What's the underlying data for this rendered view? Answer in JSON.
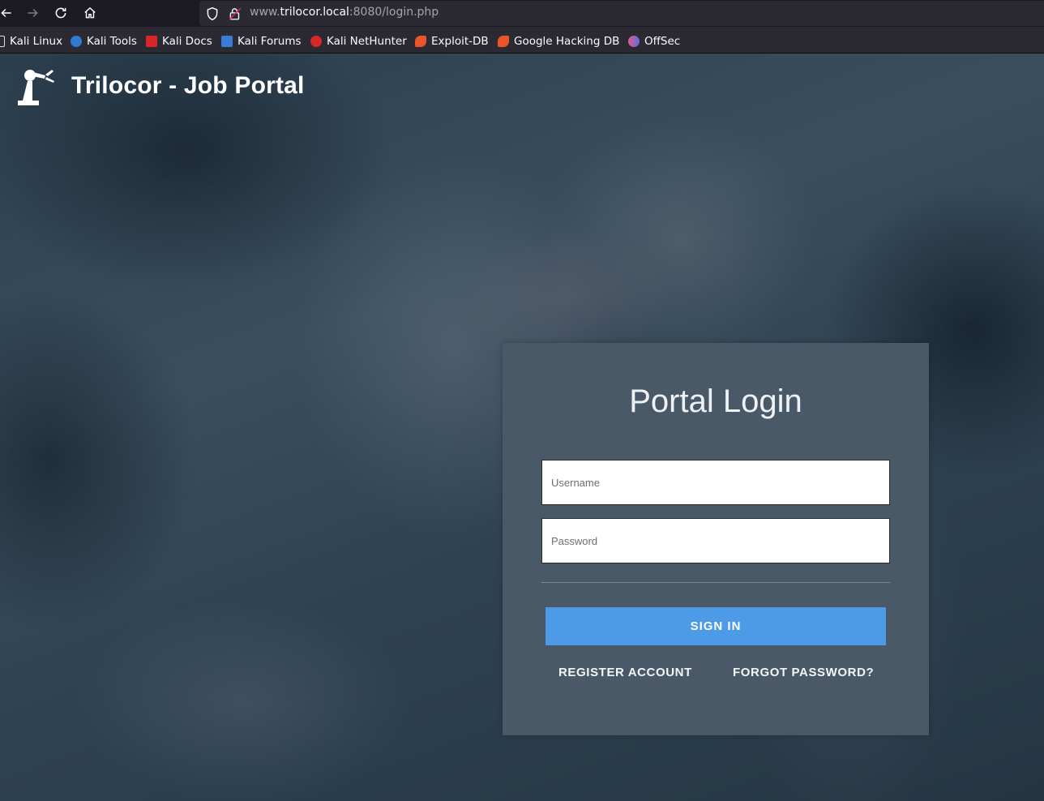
{
  "browser": {
    "url_prefix": "www.",
    "url_host": "trilocor.local",
    "url_suffix": ":8080/login.php",
    "bookmarks": [
      {
        "label": "Kali Linux",
        "color": "#ffffff"
      },
      {
        "label": "Kali Tools",
        "color": "#2e7bcf"
      },
      {
        "label": "Kali Docs",
        "color": "#d62828"
      },
      {
        "label": "Kali Forums",
        "color": "#3a7bd5"
      },
      {
        "label": "Kali NetHunter",
        "color": "#d62828"
      },
      {
        "label": "Exploit-DB",
        "color": "#e8562a"
      },
      {
        "label": "Google Hacking DB",
        "color": "#e8562a"
      },
      {
        "label": "OffSec",
        "color": "#5b6ee1"
      }
    ]
  },
  "site": {
    "brand_title": "Trilocor - Job Portal"
  },
  "login": {
    "title": "Portal Login",
    "username_placeholder": "Username",
    "password_placeholder": "Password",
    "sign_in_label": "SIGN IN",
    "register_label": "REGISTER ACCOUNT",
    "forgot_label": "FORGOT PASSWORD?"
  },
  "colors": {
    "accent": "#4d9be6",
    "card": "#4a5968"
  }
}
